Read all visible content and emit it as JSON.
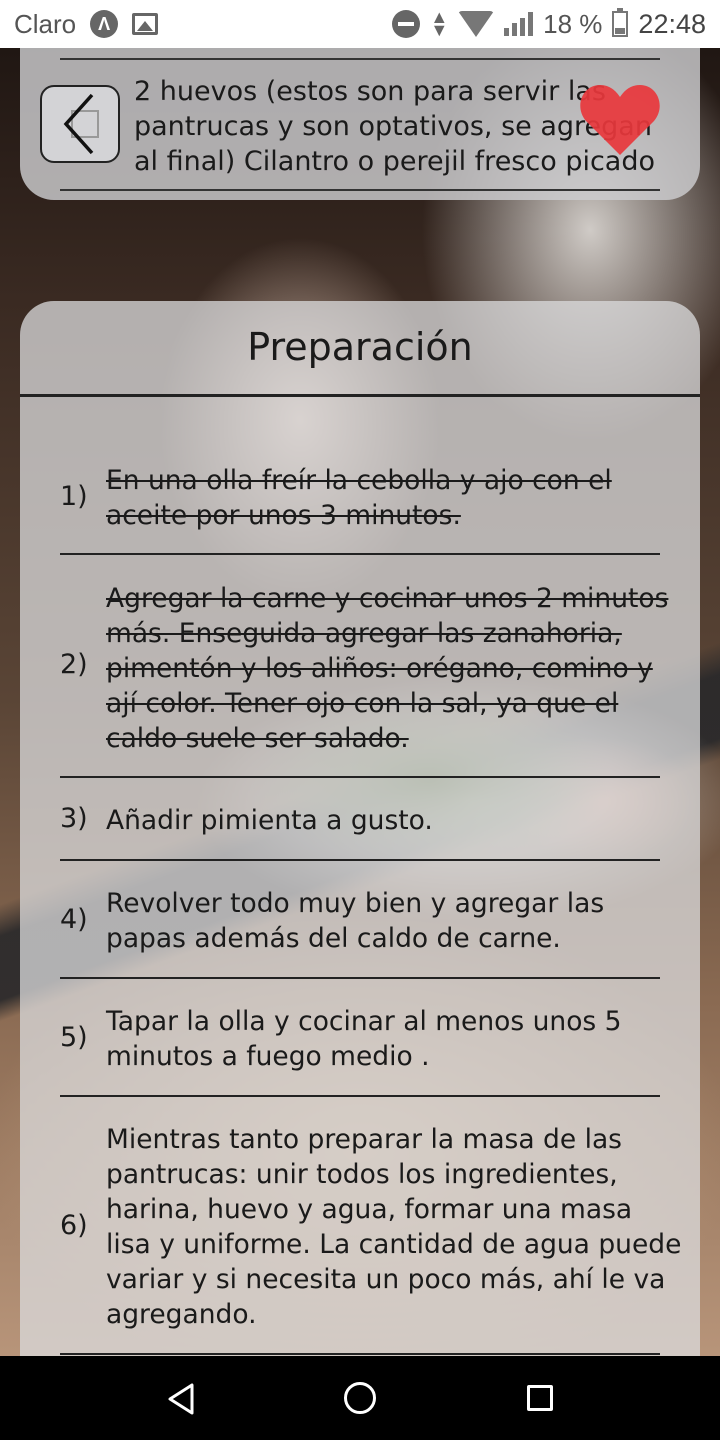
{
  "status_bar": {
    "carrier": "Claro",
    "battery": "18 %",
    "time": "22:48"
  },
  "top_card": {
    "ingredient_text": "2 huevos (estos son para servir las pantrucas y son optativos, se agregan al final) Cilantro o perejil fresco picado",
    "favorite_color": "#e8373c"
  },
  "preparation": {
    "title": "Preparación",
    "steps": [
      {
        "num": "1)",
        "text": "En una olla freír la cebolla y ajo con el aceite por unos 3 minutos.",
        "done": true
      },
      {
        "num": "2)",
        "text": "Agregar la carne y cocinar unos 2 minutos más. Enseguida agregar las zanahoria, pimentón y los aliños: orégano, comino y ají color. Tener ojo con la sal, ya que el caldo suele ser salado.",
        "done": true
      },
      {
        "num": "3)",
        "text": "Añadir pimienta a gusto.",
        "done": false
      },
      {
        "num": "4)",
        "text": "Revolver todo muy bien y agregar las papas además del caldo de carne.",
        "done": false
      },
      {
        "num": "5)",
        "text": "Tapar la olla y cocinar al menos unos 5 minutos a fuego medio .",
        "done": false
      },
      {
        "num": "6)",
        "text": "Mientras tanto preparar la masa de las pantrucas: unir todos los ingredientes, harina, huevo y agua, formar una masa lisa y uniforme. La cantidad de agua puede variar y si necesita un poco más, ahí le va agregando.",
        "done": false
      }
    ]
  },
  "icons": {
    "back": "chevron-left-icon",
    "favorite": "heart-icon",
    "nav_back": "triangle-back-icon",
    "nav_home": "circle-home-icon",
    "nav_recent": "square-recents-icon"
  }
}
